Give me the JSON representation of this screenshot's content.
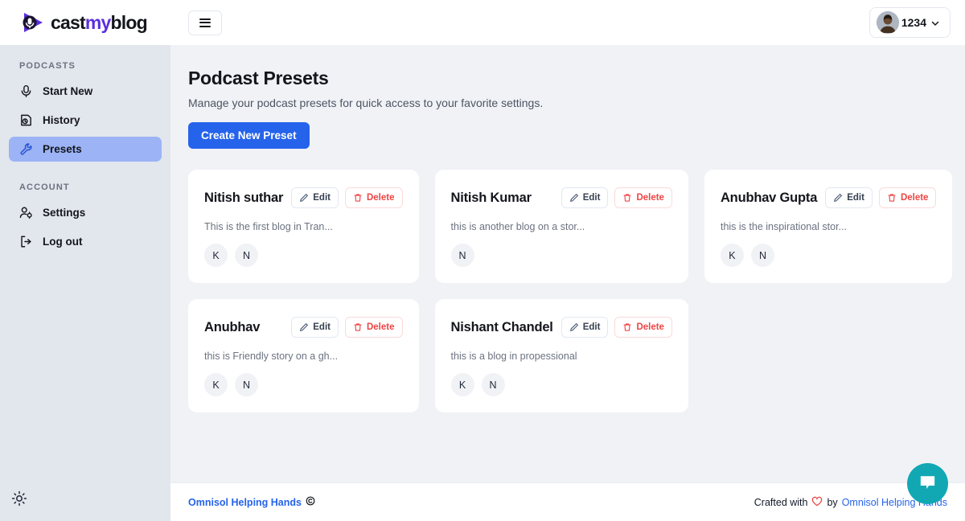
{
  "brand": {
    "name_cast": "cast",
    "name_my": "my",
    "name_blog": "blog",
    "logo_icon": "play-mic-logo-icon"
  },
  "sidebar": {
    "sections": [
      {
        "label": "PODCASTS",
        "items": [
          {
            "label": "Start New",
            "icon": "microphone-icon",
            "active": false
          },
          {
            "label": "History",
            "icon": "history-clock-icon",
            "active": false
          },
          {
            "label": "Presets",
            "icon": "wrench-icon",
            "active": true
          }
        ]
      },
      {
        "label": "ACCOUNT",
        "items": [
          {
            "label": "Settings",
            "icon": "user-gear-icon",
            "active": false
          },
          {
            "label": "Log out",
            "icon": "logout-arrow-icon",
            "active": false
          }
        ]
      }
    ],
    "theme_toggle_icon": "sun-icon"
  },
  "topbar": {
    "menu_icon": "hamburger-menu-icon",
    "user": {
      "name": "1234",
      "avatar_icon": "user-avatar-photo",
      "chevron_icon": "chevron-down-icon"
    }
  },
  "page": {
    "title": "Podcast Presets",
    "subtitle": "Manage your podcast presets for quick access to your favorite settings.",
    "create_button": "Create New Preset"
  },
  "card_actions": {
    "edit_label": "Edit",
    "edit_icon": "pencil-icon",
    "delete_label": "Delete",
    "delete_icon": "trash-icon"
  },
  "presets": [
    {
      "title": "Nitish suthar",
      "description": "This is the first blog in Tran...",
      "voices": [
        "K",
        "N"
      ]
    },
    {
      "title": "Nitish Kumar",
      "description": "this is another blog on a stor...",
      "voices": [
        "N"
      ]
    },
    {
      "title": "Anubhav Gupta",
      "description": "this is the inspirational stor...",
      "voices": [
        "K",
        "N"
      ]
    },
    {
      "title": "Anubhav",
      "description": "this is Friendly story on a gh...",
      "voices": [
        "K",
        "N"
      ]
    },
    {
      "title": "Nishant Chandel",
      "description": "this is a blog in propessional",
      "voices": [
        "K",
        "N"
      ]
    }
  ],
  "footer": {
    "left_text": "Omnisol Helping Hands",
    "left_icon": "copyright-icon",
    "crafted_prefix": "Crafted with",
    "heart_icon": "heart-icon",
    "crafted_by": "by",
    "brand_link": "Omnisol Helping Hands"
  },
  "chat_widget": {
    "icon": "chat-bubble-icon",
    "color": "#11a8b4"
  },
  "colors": {
    "accent_blue": "#2563eb",
    "active_nav": "#9cb3f5",
    "danger_red": "#ef4444",
    "brand_purple": "#5b2fe0",
    "page_bg": "#f1f2f6",
    "sidebar_bg": "#e2e6ed"
  }
}
